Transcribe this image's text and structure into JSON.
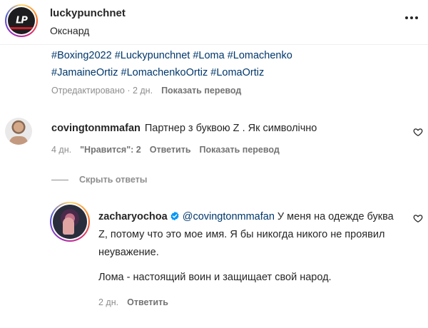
{
  "post": {
    "username": "luckypunchnet",
    "location": "Окснард",
    "avatar_text": "LP",
    "hashtags": [
      "#Boxing2022",
      "#Luckypunchnet",
      "#Loma",
      "#Lomachenko",
      "#JamaineOrtiz",
      "#LomachenkoOrtiz",
      "#LomaOrtiz"
    ],
    "edited_meta": "Отредактировано · 2 дн.",
    "translate_label": "Показать перевод"
  },
  "comment": {
    "username": "covingtonmmafan",
    "text": "Партнер з буквою Z . Як символічно",
    "time": "4 дн.",
    "likes": "\"Нравится\": 2",
    "reply_label": "Ответить",
    "translate_label": "Показать перевод"
  },
  "hide_replies_label": "Скрыть ответы",
  "reply": {
    "username": "zacharyochoa",
    "mention": "@covingtonmmafan",
    "text_part1": " У меня на одежде буква Z, потому что это мое имя. Я бы никогда никого не проявил неуважение.",
    "text_part2": "Лома - настоящий воин и защищает свой народ.",
    "time": "2 дн.",
    "reply_label": "Ответить"
  },
  "icons": {
    "more": "more-horizontal-icon",
    "heart": "heart-outline-icon",
    "verified": "verified-badge-icon"
  },
  "colors": {
    "text": "#262626",
    "secondary": "#8e8e8e",
    "link": "#00376b",
    "verified": "#0095f6"
  }
}
